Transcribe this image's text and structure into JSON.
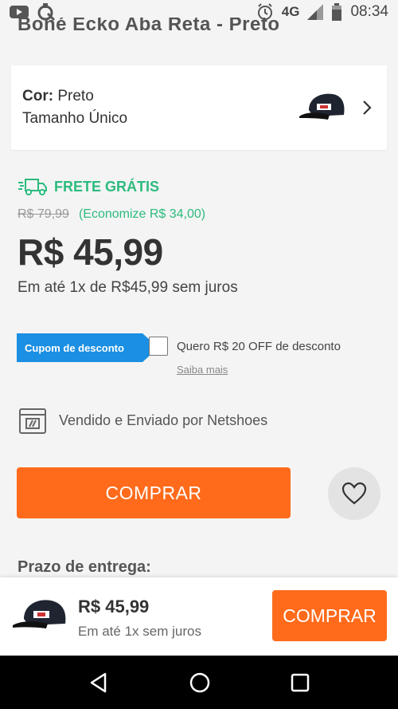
{
  "status_bar": {
    "network": "4G",
    "time": "08:34"
  },
  "product": {
    "title": "Boné Ecko Aba Reta - Preto"
  },
  "variant": {
    "color_label": "Cor:",
    "color_value": "Preto",
    "size_value": "Tamanho Único"
  },
  "pricing": {
    "shipping_label": "FRETE GRÁTIS",
    "old_price": "R$ 79,99",
    "savings": "(Economize R$ 34,00)",
    "price": "R$ 45,99",
    "installments": "Em até 1x de R$45,99 sem juros"
  },
  "coupon": {
    "tag_label": "Cupom de desconto",
    "checkbox_label": "Quero R$ 20 OFF de desconto",
    "link_label": "Saiba mais",
    "checked": false
  },
  "seller": {
    "text": "Vendido e Enviado por Netshoes"
  },
  "actions": {
    "buy_label": "COMPRAR"
  },
  "delivery": {
    "heading": "Prazo de entrega:"
  },
  "sticky_bar": {
    "price": "R$ 45,99",
    "installments": "Em até 1x sem juros",
    "buy_label": "COMPRAR"
  },
  "colors": {
    "accent_orange": "#ff6b1b",
    "green": "#2cbb7e",
    "coupon_blue": "#1a8fe3"
  }
}
